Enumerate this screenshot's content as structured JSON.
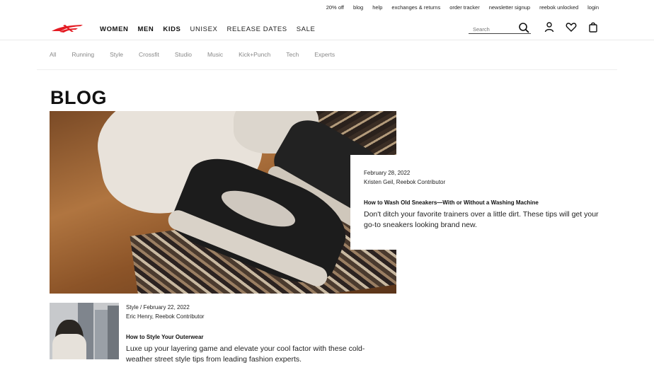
{
  "utility_links": [
    "20% off",
    "blog",
    "help",
    "exchanges & returns",
    "order tracker",
    "newsletter signup",
    "reebok unlocked",
    "login"
  ],
  "nav": {
    "links": [
      "WOMEN",
      "MEN",
      "KIDS",
      "UNISEX",
      "RELEASE DATES",
      "SALE"
    ],
    "search_placeholder": "Search"
  },
  "categories": [
    "All",
    "Running",
    "Style",
    "Crossfit",
    "Studio",
    "Music",
    "Kick+Punch",
    "Tech",
    "Experts"
  ],
  "page_title": "BLOG",
  "featured": {
    "date": "February 28, 2022",
    "author": "Kristen Geil, Reebok Contributor",
    "title": "How to Wash Old Sneakers—With or Without a Washing Machine",
    "description": "Don't ditch your favorite trainers over a little dirt. These tips will get your go-to sneakers looking brand new."
  },
  "post2": {
    "meta": "Style / February 22, 2022",
    "author": "Eric Henry, Reebok Contributor",
    "title": "How to Style Your Outerwear",
    "description": "Luxe up your layering game and elevate your cool factor with these cold-weather street style tips from leading fashion experts."
  },
  "colors": {
    "brand": "#e41b23",
    "text": "#111111",
    "muted": "#888888"
  }
}
